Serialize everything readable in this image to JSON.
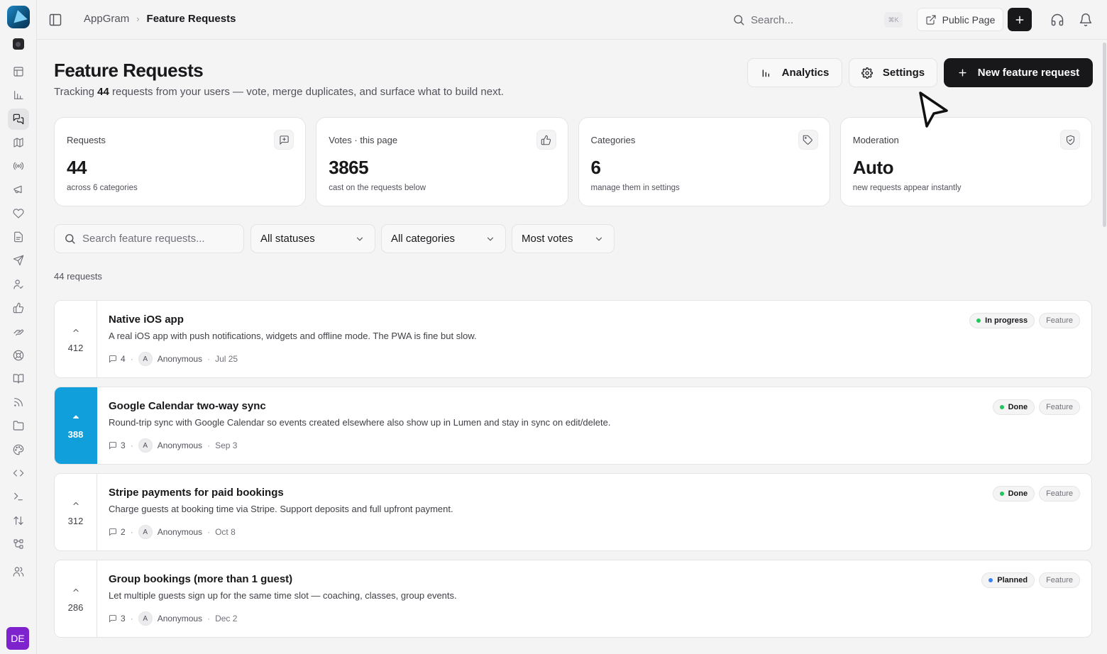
{
  "app": {
    "user_initials": "DE"
  },
  "topbar": {
    "breadcrumb_root": "AppGram",
    "breadcrumb_current": "Feature Requests",
    "search_placeholder": "Search...",
    "search_shortcut": "⌘K",
    "public_page_label": "Public Page"
  },
  "header": {
    "title": "Feature Requests",
    "subtitle_prefix": "Tracking ",
    "subtitle_count": "44",
    "subtitle_suffix": " requests from your users — vote, merge duplicates, and surface what to build next.",
    "analytics_label": "Analytics",
    "settings_label": "Settings",
    "new_request_label": "New feature request"
  },
  "stats": [
    {
      "label": "Requests",
      "value": "44",
      "note": "across 6 categories",
      "icon": "message-square-icon"
    },
    {
      "label": "Votes · this page",
      "value": "3865",
      "note": "cast on the requests below",
      "icon": "thumbs-up-icon"
    },
    {
      "label": "Categories",
      "value": "6",
      "note": "manage them in settings",
      "icon": "tag-icon"
    },
    {
      "label": "Moderation",
      "value": "Auto",
      "note": "new requests appear instantly",
      "icon": "shield-check-icon"
    }
  ],
  "filters": {
    "search_placeholder": "Search feature requests...",
    "status": "All statuses",
    "category": "All categories",
    "sort": "Most votes"
  },
  "list": {
    "count_label": "44 requests",
    "items": [
      {
        "votes": "412",
        "voted": false,
        "title": "Native iOS app",
        "description": "A real iOS app with push notifications, widgets and offline mode. The PWA is fine but slow.",
        "comments": "4",
        "avatar": "A",
        "author": "Anonymous",
        "date": "Jul 25",
        "status": "In progress",
        "status_color": "#22c55e",
        "type": "Feature"
      },
      {
        "votes": "388",
        "voted": true,
        "title": "Google Calendar two-way sync",
        "description": "Round-trip sync with Google Calendar so events created elsewhere also show up in Lumen and stay in sync on edit/delete.",
        "comments": "3",
        "avatar": "A",
        "author": "Anonymous",
        "date": "Sep 3",
        "status": "Done",
        "status_color": "#22c55e",
        "type": "Feature"
      },
      {
        "votes": "312",
        "voted": false,
        "title": "Stripe payments for paid bookings",
        "description": "Charge guests at booking time via Stripe. Support deposits and full upfront payment.",
        "comments": "2",
        "avatar": "A",
        "author": "Anonymous",
        "date": "Oct 8",
        "status": "Done",
        "status_color": "#22c55e",
        "type": "Feature"
      },
      {
        "votes": "286",
        "voted": false,
        "title": "Group bookings (more than 1 guest)",
        "description": "Let multiple guests sign up for the same time slot — coaching, classes, group events.",
        "comments": "3",
        "avatar": "A",
        "author": "Anonymous",
        "date": "Dec 2",
        "status": "Planned",
        "status_color": "#3b82f6",
        "type": "Feature"
      }
    ]
  }
}
